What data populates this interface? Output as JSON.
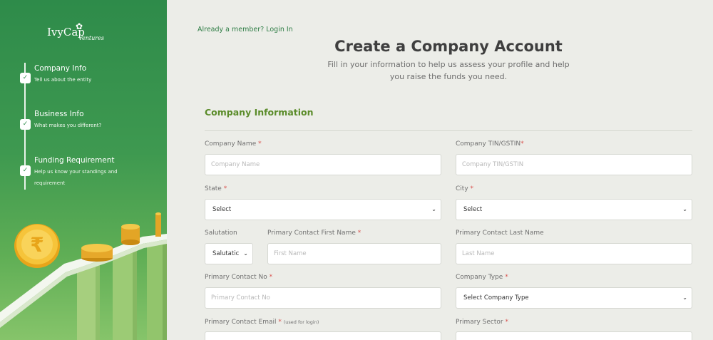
{
  "sidebar": {
    "logo": {
      "main": "IvyCap",
      "sub": "Ventures"
    },
    "steps": [
      {
        "title": "Company Info",
        "subtitle": "Tell us about the entity"
      },
      {
        "title": "Business Info",
        "subtitle": "What makes you different?"
      },
      {
        "title": "Funding Requirement",
        "subtitle": "Help us know your standings and requirement"
      }
    ]
  },
  "header": {
    "login_link": "Already a member? Login In",
    "title": "Create a Company Account",
    "subtitle": "Fill in your information to help us assess your profile and help you raise the funds you need."
  },
  "form": {
    "section_title": "Company Information",
    "required_mark": "*",
    "company_name": {
      "label": "Company Name",
      "placeholder": "Company Name"
    },
    "company_tin": {
      "label": "Company TIN/GSTIN",
      "placeholder": "Company TIN/GSTIN"
    },
    "state": {
      "label": "State",
      "value": "Select"
    },
    "city": {
      "label": "City",
      "value": "Select"
    },
    "salutation": {
      "label": "Salutation",
      "value": "Salutatic"
    },
    "first_name": {
      "label": "Primary Contact First Name",
      "placeholder": "First Name"
    },
    "last_name": {
      "label": "Primary Contact Last Name",
      "placeholder": "Last Name"
    },
    "contact_no": {
      "label": "Primary Contact No",
      "placeholder": "Primary Contact No"
    },
    "company_type": {
      "label": "Company Type",
      "value": "Select Company Type"
    },
    "contact_email": {
      "label": "Primary Contact Email",
      "note": "(used for login)"
    },
    "primary_sector": {
      "label": "Primary Sector"
    }
  },
  "colors": {
    "sidebar_green": "#2e8b4a",
    "accent_green": "#5b8c2a",
    "required_red": "#d9534f",
    "background": "#ecede8"
  }
}
